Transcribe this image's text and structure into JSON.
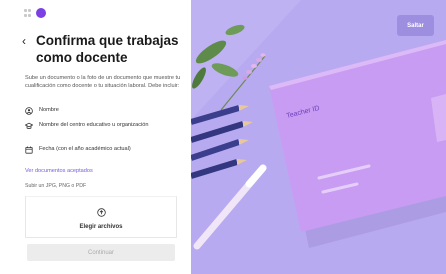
{
  "panel": {
    "back_glyph": "‹",
    "title": "Confirma que trabajas como docente",
    "description": "Sube un documento o la foto de un documento que muestre tu cualificación como docente o tu situación laboral. Debe incluir:",
    "requirements": [
      {
        "icon": "person-circle-icon",
        "label": "Nombre"
      },
      {
        "icon": "school-icon",
        "label": "Nombre del centro educativo u organización"
      },
      {
        "icon": "calendar-icon",
        "label": "Fecha (con el año académico actual)"
      }
    ],
    "link": "Ver documentos aceptados",
    "formats": "Subir un JPG, PNG o PDF",
    "upload_label": "Elegir archivos",
    "upload_icon": "upload-icon",
    "continue_label": "Continuar"
  },
  "art": {
    "skip_label": "Saltar",
    "card_label": "Teacher ID"
  },
  "colors": {
    "brand": "#7b3fe4",
    "background_art": "#b8aaf0",
    "card": "#c89cf2",
    "pencil": "#3a3e8c"
  }
}
